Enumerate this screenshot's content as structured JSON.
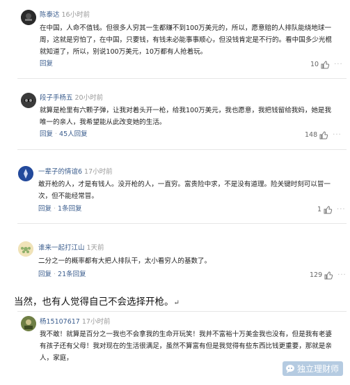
{
  "comments": [
    {
      "user": "陈泰达",
      "time": "16小时前",
      "lines": [
        "在中国，人命不值钱。但很多人穷其一生都赚不到100万美元的，所以，愿意赔的人排队能绕地球一",
        "周，这就是穷怕了，在中国，只要钱，有钱未必能事事顺心，但没钱肯定是不行的。看中国多少光棍",
        "就知道了，所以，别说100万美元，10万都有人抢着玩。"
      ],
      "reply_label": "回复",
      "likes": "10"
    },
    {
      "user": "段子手杨五",
      "time": "20小时前",
      "lines": [
        "就算是枪里有六颗子弹，让我对着头开一枪，给我100万美元，我也愿意，我把钱留给我妈，她是我",
        "唯一的亲人，我希望能从此改变她的生活。"
      ],
      "reply_label": "回复",
      "replies_label": "45人回复",
      "likes": "148"
    },
    {
      "user": "一辈子的情谊6",
      "time": "17小时前",
      "lines": [
        "敢开枪的人，才是有钱人。没开枪的人，一直穷。富贵险中求，不是没有道理。险关键时刻可以冒一",
        "次，但不能经常冒。"
      ],
      "reply_label": "回复",
      "replies_label": "1条回复",
      "likes": "1"
    },
    {
      "user": "谁来一起打江山",
      "time": "1天前",
      "lines": [
        "二分之一的概率都有大把人排队干，太小看穷人的基数了。"
      ],
      "reply_label": "回复",
      "replies_label": "21条回复",
      "likes": "129"
    },
    {
      "user": "杨15107617",
      "time": "17小时前",
      "lines": [
        "我不敢！就算是百分之一我也不会拿我的生命开玩笑！我并不富裕十万美金我也没有，但是我有老婆",
        "有孩子还有父母！我对现在的生活很满足，虽然不算富有但是我觉得有些东西比钱更重要，那就是亲",
        "人，家庭，"
      ]
    }
  ],
  "article_text": "当然，也有人觉得自己不会选择开枪。",
  "article_mark": "↵",
  "watermark": "独立理财师",
  "colors": {
    "link": "#3a5c8d",
    "text": "#222222",
    "divider": "#e6e6e6"
  }
}
